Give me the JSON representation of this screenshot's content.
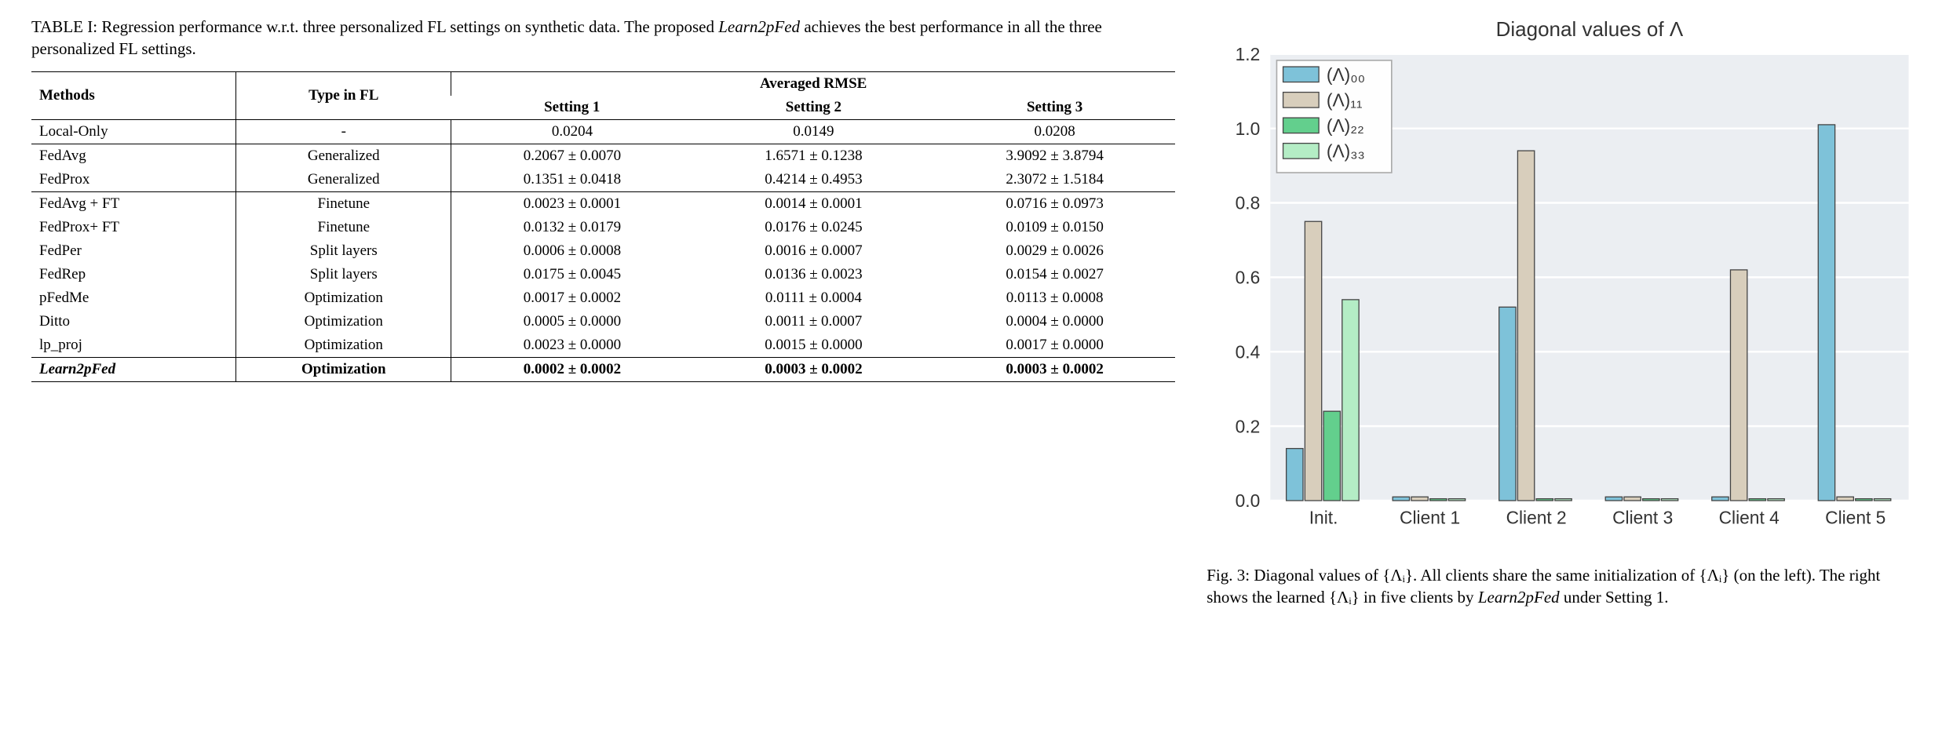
{
  "table": {
    "caption_prefix": "TABLE I: ",
    "caption_body": "Regression performance w.r.t. three personalized FL settings on synthetic data. The proposed ",
    "caption_method": "Learn2pFed",
    "caption_tail": " achieves the best performance in all the three personalized FL settings.",
    "head": {
      "methods": "Methods",
      "type": "Type in FL",
      "rmse": "Averaged RMSE",
      "s1": "Setting 1",
      "s2": "Setting 2",
      "s3": "Setting 3"
    },
    "rows": [
      {
        "m": "Local-Only",
        "t": "-",
        "s1": "0.0204",
        "s2": "0.0149",
        "s3": "0.0208",
        "sep_before": true
      },
      {
        "m": "FedAvg",
        "t": "Generalized",
        "s1": "0.2067 ± 0.0070",
        "s2": "1.6571 ± 0.1238",
        "s3": "3.9092 ± 3.8794",
        "sep_before": true
      },
      {
        "m": "FedProx",
        "t": "Generalized",
        "s1": "0.1351 ± 0.0418",
        "s2": "0.4214 ± 0.4953",
        "s3": "2.3072 ± 1.5184"
      },
      {
        "m": "FedAvg + FT",
        "t": "Finetune",
        "s1": "0.0023 ± 0.0001",
        "s2": "0.0014 ± 0.0001",
        "s3": "0.0716 ± 0.0973",
        "sep_before": true
      },
      {
        "m": "FedProx+ FT",
        "t": "Finetune",
        "s1": "0.0132 ± 0.0179",
        "s2": "0.0176 ± 0.0245",
        "s3": "0.0109 ± 0.0150"
      },
      {
        "m": "FedPer",
        "t": "Split layers",
        "s1": "0.0006 ± 0.0008",
        "s2": "0.0016 ± 0.0007",
        "s3": "0.0029 ± 0.0026"
      },
      {
        "m": "FedRep",
        "t": "Split layers",
        "s1": "0.0175 ± 0.0045",
        "s2": "0.0136 ± 0.0023",
        "s3": "0.0154 ± 0.0027"
      },
      {
        "m": "pFedMe",
        "t": "Optimization",
        "s1": "0.0017 ± 0.0002",
        "s2": "0.0111 ± 0.0004",
        "s3": "0.0113 ± 0.0008"
      },
      {
        "m": "Ditto",
        "t": "Optimization",
        "s1": "0.0005 ± 0.0000",
        "s2": "0.0011 ± 0.0007",
        "s3": "0.0004 ± 0.0000"
      },
      {
        "m": "lp_proj",
        "t": "Optimization",
        "s1": "0.0023 ± 0.0000",
        "s2": "0.0015 ± 0.0000",
        "s3": "0.0017 ± 0.0000"
      },
      {
        "m": "Learn2pFed",
        "t": "Optimization",
        "s1": "0.0002 ± 0.0002",
        "s2": "0.0003 ± 0.0002",
        "s3": "0.0003 ± 0.0002",
        "bold": true,
        "sep_before": true,
        "sep_after": true
      }
    ]
  },
  "figure": {
    "caption_prefix": "Fig. 3: ",
    "caption_body1": "Diagonal values of {Λᵢ}. All clients share the same initialization of {Λᵢ} (on the left). The right shows the learned {Λᵢ} in five clients by ",
    "caption_method": "Learn2pFed",
    "caption_tail": " under Setting 1."
  },
  "chart_data": {
    "type": "bar",
    "title": "Diagonal values of Λ",
    "ylabel": "",
    "ylim": [
      0.0,
      1.2
    ],
    "yticks": [
      0.0,
      0.2,
      0.4,
      0.6,
      0.8,
      1.0,
      1.2
    ],
    "categories": [
      "Init.",
      "Client 1",
      "Client 2",
      "Client 3",
      "Client 4",
      "Client 5"
    ],
    "series": [
      {
        "name": "(Λ)₀₀",
        "color": "#7ec2d9",
        "values": [
          0.14,
          0.01,
          0.52,
          0.01,
          0.01,
          1.01
        ]
      },
      {
        "name": "(Λ)₁₁",
        "color": "#d8cebc",
        "values": [
          0.75,
          0.01,
          0.94,
          0.01,
          0.62,
          0.01
        ]
      },
      {
        "name": "(Λ)₂₂",
        "color": "#63cf8d",
        "values": [
          0.24,
          0.005,
          0.005,
          0.005,
          0.005,
          0.005
        ]
      },
      {
        "name": "(Λ)₃₃",
        "color": "#b4edc5",
        "values": [
          0.54,
          0.005,
          0.005,
          0.005,
          0.005,
          0.005
        ]
      }
    ],
    "legend_pos": "top-left"
  }
}
